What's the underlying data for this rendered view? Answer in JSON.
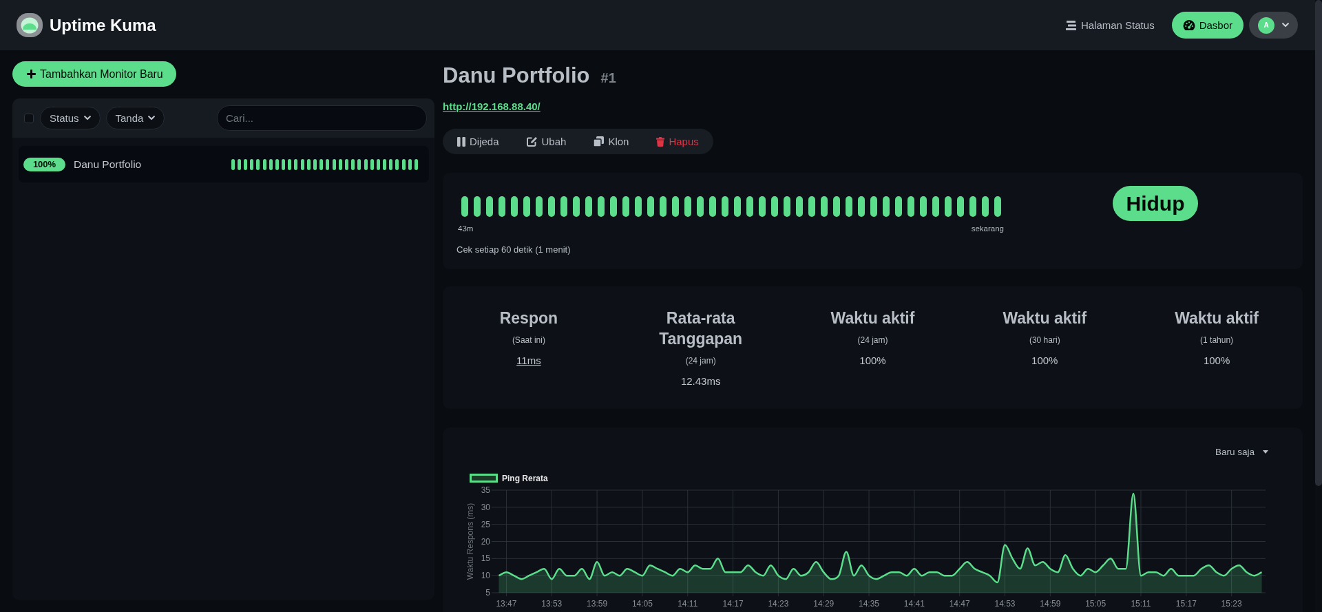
{
  "header": {
    "title": "Uptime Kuma",
    "status_page_link": "Halaman Status",
    "dashboard_button": "Dasbor",
    "user_avatar": "A"
  },
  "sidebar": {
    "add_button": "Tambahkan Monitor Baru",
    "select_all": {
      "checked": false
    },
    "filters": [
      {
        "label": "Status"
      },
      {
        "label": "Tanda"
      }
    ],
    "search": {
      "placeholder": "Cari..."
    },
    "monitors": [
      {
        "uptime": "100%",
        "name": "Danu Portfolio",
        "selected": true,
        "heartbeats": [
          {
            "up": true
          },
          {
            "up": true
          },
          {
            "up": true
          },
          {
            "up": true
          },
          {
            "up": true
          },
          {
            "up": true
          },
          {
            "up": true
          },
          {
            "up": true
          },
          {
            "up": true
          },
          {
            "up": true
          },
          {
            "up": true
          },
          {
            "up": true
          },
          {
            "up": true
          },
          {
            "up": true
          },
          {
            "up": true
          },
          {
            "up": true
          },
          {
            "up": true
          },
          {
            "up": true
          },
          {
            "up": true
          },
          {
            "up": true
          },
          {
            "up": true
          },
          {
            "up": true
          },
          {
            "up": true
          },
          {
            "up": true
          },
          {
            "up": true
          },
          {
            "up": true
          },
          {
            "up": true
          },
          {
            "up": true
          },
          {
            "up": true
          },
          {
            "up": true
          }
        ]
      }
    ]
  },
  "monitor": {
    "title": "Danu Portfolio",
    "id": "#1",
    "url": "http://192.168.88.40/",
    "actions": [
      {
        "kind": "pause",
        "label": "Dijeda"
      },
      {
        "kind": "edit",
        "label": "Ubah"
      },
      {
        "kind": "clone",
        "label": "Klon"
      },
      {
        "kind": "delete",
        "label": "Hapus"
      }
    ]
  },
  "heartbeat_panel": {
    "heartbeats": [
      {
        "up": true
      },
      {
        "up": true
      },
      {
        "up": true
      },
      {
        "up": true
      },
      {
        "up": true
      },
      {
        "up": true
      },
      {
        "up": true
      },
      {
        "up": true
      },
      {
        "up": true
      },
      {
        "up": true
      },
      {
        "up": true
      },
      {
        "up": true
      },
      {
        "up": true
      },
      {
        "up": true
      },
      {
        "up": true
      },
      {
        "up": true
      },
      {
        "up": true
      },
      {
        "up": true
      },
      {
        "up": true
      },
      {
        "up": true
      },
      {
        "up": true
      },
      {
        "up": true
      },
      {
        "up": true
      },
      {
        "up": true
      },
      {
        "up": true
      },
      {
        "up": true
      },
      {
        "up": true
      },
      {
        "up": true
      },
      {
        "up": true
      },
      {
        "up": true
      },
      {
        "up": true
      },
      {
        "up": true
      },
      {
        "up": true
      },
      {
        "up": true
      },
      {
        "up": true
      },
      {
        "up": true
      },
      {
        "up": true
      },
      {
        "up": true
      },
      {
        "up": true
      },
      {
        "up": true
      },
      {
        "up": true
      },
      {
        "up": true
      },
      {
        "up": true
      },
      {
        "up": true
      }
    ],
    "start_label": "43m",
    "end_label": "sekarang",
    "interval_text": "Cek setiap 60 detik (1 menit)",
    "up": true,
    "status_label": "Hidup"
  },
  "stats": [
    {
      "title": "Respon",
      "subtitle": "(Saat ini)",
      "value": "11ms",
      "kind": "link"
    },
    {
      "title": "Rata-rata Tanggapan",
      "subtitle": "(24 jam)",
      "value": "12.43ms",
      "kind": "text"
    },
    {
      "title": "Waktu aktif",
      "subtitle": "(24 jam)",
      "value": "100%",
      "kind": "text"
    },
    {
      "title": "Waktu aktif",
      "subtitle": "(30 hari)",
      "value": "100%",
      "kind": "text"
    },
    {
      "title": "Waktu aktif",
      "subtitle": "(1 tahun)",
      "value": "100%",
      "kind": "text"
    }
  ],
  "chart": {
    "range": "Baru saja",
    "chart_data": {
      "type": "area",
      "ylabel": "Waktu Respons (ms)",
      "grid": true,
      "x": [
        826,
        827,
        828,
        829,
        830,
        831,
        832,
        833,
        834,
        835,
        836,
        837,
        838,
        839,
        840,
        841,
        842,
        843,
        844,
        845,
        846,
        847,
        848,
        849,
        850,
        851,
        852,
        853,
        854,
        855,
        856,
        857,
        858,
        859,
        860,
        861,
        862,
        863,
        864,
        865,
        866,
        867,
        868,
        869,
        870,
        871,
        872,
        873,
        874,
        875,
        876,
        877,
        878,
        879,
        880,
        881,
        882,
        883,
        884,
        885,
        886,
        887,
        888,
        889,
        890,
        891,
        892,
        893,
        894,
        895,
        896,
        897,
        898,
        899,
        900,
        901,
        902,
        903,
        904,
        905,
        906,
        907,
        908,
        909,
        910,
        911,
        912,
        913,
        914,
        915,
        916,
        917,
        918,
        919,
        920,
        921,
        922,
        923,
        924,
        925,
        926,
        927
      ],
      "series": [
        {
          "name": "Ping Rerata",
          "color": "#5cdd8b",
          "values": [
            10,
            11,
            10,
            9,
            10,
            11,
            12,
            9,
            12,
            10,
            10,
            12,
            9,
            14,
            10,
            11,
            10,
            12,
            11,
            10,
            13,
            12,
            11,
            10,
            12,
            11,
            13,
            12,
            12,
            15,
            11,
            11,
            11,
            13,
            11,
            10,
            13,
            10,
            9,
            12,
            10,
            11,
            14,
            11,
            9,
            10,
            17,
            10,
            13,
            10,
            9,
            10,
            11,
            11,
            10,
            12,
            10,
            11,
            11,
            10,
            10,
            12,
            14,
            12,
            11,
            10,
            8,
            19,
            15,
            12,
            18,
            13,
            14,
            12,
            11,
            16,
            12,
            10,
            12,
            11,
            13,
            15,
            12,
            12,
            34,
            10,
            11,
            11,
            10,
            12,
            10,
            10,
            10,
            12,
            13,
            11,
            10,
            12,
            13,
            11,
            10,
            11
          ]
        }
      ],
      "xlim": [
        825.5,
        927.5
      ],
      "ylim": [
        5,
        35
      ],
      "yticks": [
        5,
        10,
        15,
        20,
        25,
        30,
        35
      ],
      "xticks": [
        {
          "value": 827,
          "label": "13:47"
        },
        {
          "value": 833,
          "label": "13:53"
        },
        {
          "value": 839,
          "label": "13:59"
        },
        {
          "value": 845,
          "label": "14:05"
        },
        {
          "value": 851,
          "label": "14:11"
        },
        {
          "value": 857,
          "label": "14:17"
        },
        {
          "value": 863,
          "label": "14:23"
        },
        {
          "value": 869,
          "label": "14:29"
        },
        {
          "value": 875,
          "label": "14:35"
        },
        {
          "value": 881,
          "label": "14:41"
        },
        {
          "value": 887,
          "label": "14:47"
        },
        {
          "value": 893,
          "label": "14:53"
        },
        {
          "value": 899,
          "label": "14:59"
        },
        {
          "value": 905,
          "label": "15:05"
        },
        {
          "value": 911,
          "label": "15:11"
        },
        {
          "value": 917,
          "label": "15:17"
        },
        {
          "value": 923,
          "label": "15:23"
        }
      ]
    }
  }
}
